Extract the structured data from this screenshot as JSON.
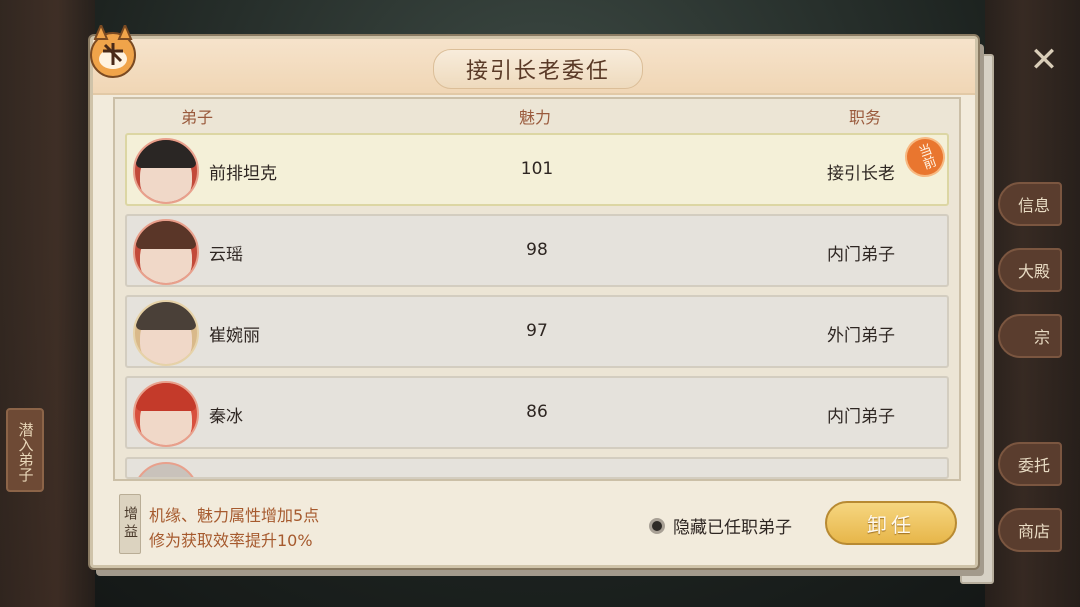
{
  "dialog": {
    "title": "接引长老委任",
    "columns": {
      "name": "弟子",
      "charm": "魅力",
      "post": "职务"
    },
    "rows": [
      {
        "name": "前排坦克",
        "charm": "101",
        "post": "接引长老",
        "current_badge": "当前"
      },
      {
        "name": "云瑶",
        "charm": "98",
        "post": "内门弟子"
      },
      {
        "name": "崔婉丽",
        "charm": "97",
        "post": "外门弟子"
      },
      {
        "name": "秦冰",
        "charm": "86",
        "post": "内门弟子"
      }
    ],
    "buff_tag": "增益",
    "buff_lines": [
      "机缘、魅力属性增加5点",
      "修为获取效率提升10%"
    ],
    "hide_option": "隐藏已任职弟子",
    "dismiss_button": "卸任"
  },
  "background": {
    "left_tag": "潜入弟子",
    "right_buttons": [
      "信息",
      "大殿",
      "宗",
      "委托",
      "商店"
    ],
    "close_icon": "close-icon"
  },
  "colors": {
    "accent": "#e7b64a",
    "header_text": "#9a5a3c",
    "buff_text": "#a65a2e",
    "badge": "#e9762f"
  }
}
